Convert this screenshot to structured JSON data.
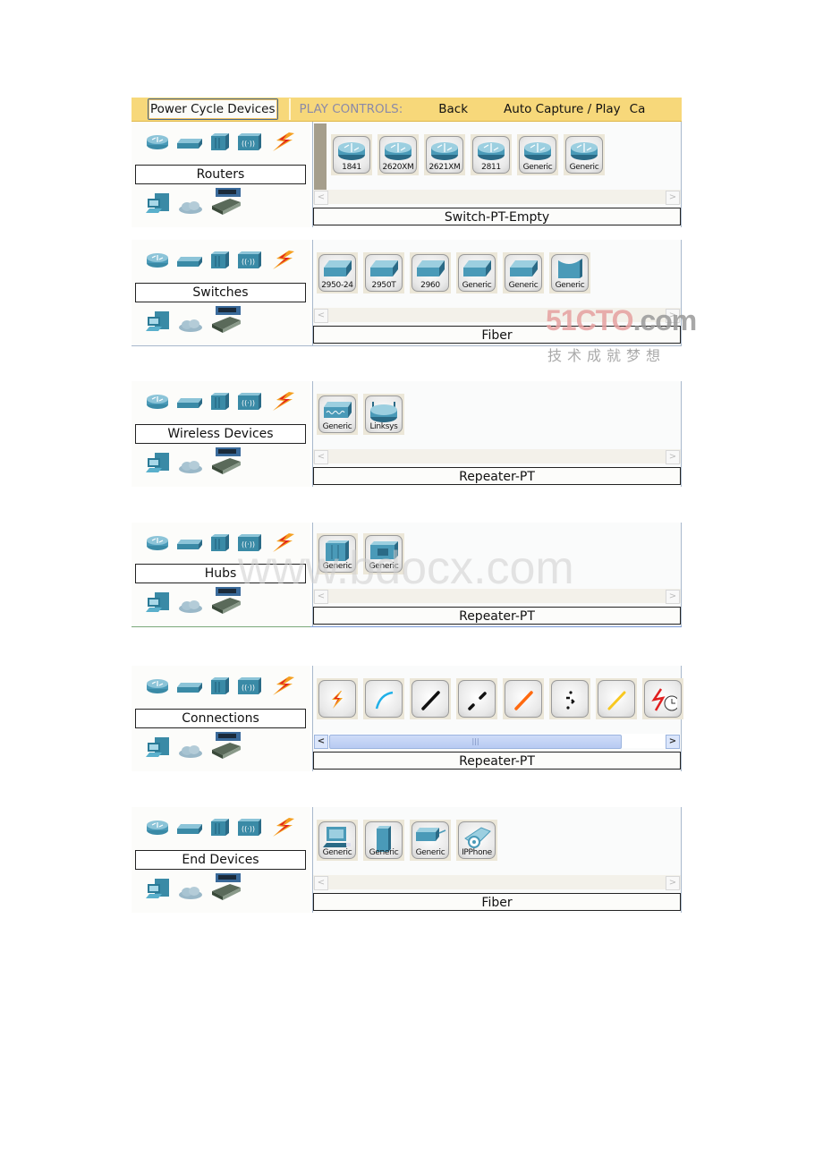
{
  "toolbar": {
    "power_cycle": "Power Cycle Devices",
    "play_controls": "PLAY CONTROLS:",
    "back": "Back",
    "auto_capture": "Auto Capture / Play",
    "capture_partial": "Ca"
  },
  "category_icons": [
    "router-icon",
    "switch-icon",
    "hub-icon",
    "wireless-icon",
    "connection-icon"
  ],
  "category_icons_row2": [
    "end-device-icon",
    "cloud-icon",
    "custom-device-icon"
  ],
  "sections": [
    {
      "category": "Routers",
      "devices": [
        "1841",
        "2620XM",
        "2621XM",
        "2811",
        "Generic",
        "Generic"
      ],
      "device_type": "router",
      "status_label": "Switch-PT-Empty"
    },
    {
      "category": "Switches",
      "devices": [
        "2950-24",
        "2950T",
        "2960",
        "Generic",
        "Generic",
        "Generic"
      ],
      "device_type": "switch",
      "status_label": "Fiber"
    },
    {
      "category": "Wireless Devices",
      "devices": [
        "Generic",
        "Linksys"
      ],
      "device_type": "wireless",
      "status_label": "Repeater-PT"
    },
    {
      "category": "Hubs",
      "devices": [
        "Generic",
        "Generic"
      ],
      "device_type": "hub",
      "status_label": "Repeater-PT"
    },
    {
      "category": "Connections",
      "devices": [
        "Automatic",
        "Console",
        "Copper Straight-Through",
        "Copper Cross-Over",
        "Fiber",
        "Phone",
        "Coaxial",
        "Serial DCE"
      ],
      "device_type": "connection",
      "status_label": "Repeater-PT"
    },
    {
      "category": "End Devices",
      "devices": [
        "Generic",
        "Generic",
        "Generic",
        "IPPhone"
      ],
      "device_type": "end",
      "status_label": "Fiber"
    }
  ],
  "watermarks": {
    "brand_red": "51CTO",
    "brand_grey": ".com",
    "brand_cn": "技术成就梦想",
    "site": "www.bdocx.com"
  }
}
